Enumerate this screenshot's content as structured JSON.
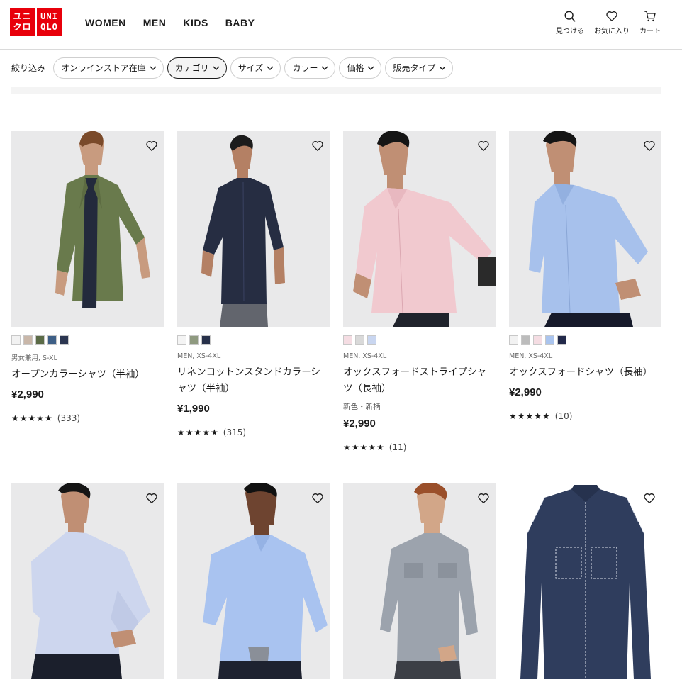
{
  "header": {
    "logo_top": [
      "ユニ",
      "クロ"
    ],
    "logo_bottom": [
      "UNI",
      "QLO"
    ],
    "nav": [
      "WOMEN",
      "MEN",
      "KIDS",
      "BABY"
    ],
    "utility": [
      {
        "icon": "search-icon",
        "label": "見つける"
      },
      {
        "icon": "heart-icon",
        "label": "お気に入り"
      },
      {
        "icon": "cart-icon",
        "label": "カート"
      }
    ]
  },
  "filters": {
    "refine_label": "絞り込み",
    "chips": [
      "オンラインストア在庫",
      "カテゴリ",
      "サイズ",
      "カラー",
      "価格",
      "販売タイプ"
    ],
    "active_chip": "カテゴリ"
  },
  "products": [
    {
      "meta": "男女兼用, S-XL",
      "name": "オープンカラーシャツ（半袖）",
      "tag": "",
      "price": "¥2,990",
      "review_count": "(333)",
      "rating": 4.5,
      "swatches": [
        "#f2f2f2",
        "#c9b7a9",
        "#5b6b47",
        "#3e5f86",
        "#2b3550"
      ]
    },
    {
      "meta": "MEN, XS-4XL",
      "name": "リネンコットンスタンドカラーシャツ（半袖）",
      "tag": "",
      "price": "¥1,990",
      "review_count": "(315)",
      "rating": 4.5,
      "swatches": [
        "#f4f4f4",
        "#8f9a80",
        "#27314a"
      ]
    },
    {
      "meta": "MEN, XS-4XL",
      "name": "オックスフォードストライプシャツ（長袖）",
      "tag": "新色・新柄",
      "price": "¥2,990",
      "review_count": "(11)",
      "rating": 4.5,
      "swatches": [
        "#f5dde3",
        "#d9d9d9",
        "#c9d6f0"
      ]
    },
    {
      "meta": "MEN, XS-4XL",
      "name": "オックスフォードシャツ（長袖）",
      "tag": "",
      "price": "¥2,990",
      "review_count": "(10)",
      "rating": 4.5,
      "swatches": [
        "#f2f2f2",
        "#bcbcbc",
        "#f5dde3",
        "#aac4ee",
        "#22294a"
      ]
    },
    {
      "meta": "",
      "name": "",
      "tag": "",
      "price": "",
      "review_count": "",
      "rating": null,
      "swatches": []
    },
    {
      "meta": "",
      "name": "",
      "tag": "",
      "price": "",
      "review_count": "",
      "rating": null,
      "swatches": []
    },
    {
      "meta": "",
      "name": "",
      "tag": "",
      "price": "",
      "review_count": "",
      "rating": null,
      "swatches": []
    },
    {
      "meta": "",
      "name": "",
      "tag": "",
      "price": "",
      "review_count": "",
      "rating": null,
      "swatches": []
    }
  ],
  "stars_text": "★★★★★",
  "colors": {
    "brand_red": "#e8000b",
    "photo_bg": "#e9e9ea",
    "text": "#1b1b1b"
  }
}
